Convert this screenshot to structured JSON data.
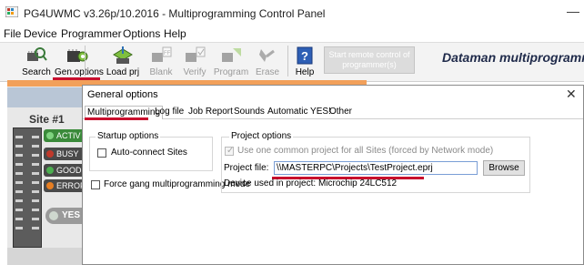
{
  "window": {
    "title": "PG4UWMC v3.26p/10.2016 - Multiprogramming Control Panel",
    "minimize_glyph": "—",
    "app_icon": "app-logo-icon"
  },
  "menu": [
    "File",
    "Device",
    "Programmer",
    "Options",
    "Help"
  ],
  "toolbar": {
    "buttons": [
      {
        "label": "Search",
        "icon": "search-chip-icon",
        "enabled": true
      },
      {
        "label": "Gen.options",
        "icon": "gen-options-icon",
        "enabled": true
      },
      {
        "label": "Load prj",
        "icon": "load-project-icon",
        "enabled": true
      },
      {
        "label": "Blank",
        "icon": "blank-icon",
        "enabled": false
      },
      {
        "label": "Verify",
        "icon": "verify-icon",
        "enabled": false
      },
      {
        "label": "Program",
        "icon": "program-icon",
        "enabled": false
      },
      {
        "label": "Erase",
        "icon": "erase-icon",
        "enabled": false
      },
      {
        "label": "Help",
        "icon": "help-icon",
        "enabled": true
      }
    ],
    "remote_button": "Start remote control of programmer(s)",
    "brand": "Dataman multiprogrammin"
  },
  "site": {
    "title": "Site #1",
    "statuses": [
      {
        "label": "ACTIV",
        "color": "#3a8a3a",
        "dot": "#7fd37f"
      },
      {
        "label": "BUSY",
        "color": "#4a4a4a",
        "dot": "#c0392b"
      },
      {
        "label": "GOOD",
        "color": "#4a4a4a",
        "dot": "#4caf50"
      },
      {
        "label": "ERROF",
        "color": "#4a4a4a",
        "dot": "#e67e22"
      }
    ],
    "yes_label": "YES"
  },
  "dialog": {
    "title": "General options",
    "close_glyph": "✕",
    "tabs": [
      "Multiprogramming",
      "Log file",
      "Job Report",
      "Sounds",
      "Automatic YES!",
      "Other"
    ],
    "active_tab": "Multiprogramming",
    "startup": {
      "title": "Startup options",
      "auto_connect": "Auto-connect Sites",
      "auto_connect_checked": false
    },
    "force_gang": "Force gang multiprogramming mode",
    "force_gang_checked": false,
    "project": {
      "title": "Project options",
      "use_common": "Use one common project for all Sites (forced by Network mode)",
      "use_common_checked": true,
      "file_label": "Project file:",
      "file_value": "\\\\MASTERPC\\Projects\\TestProject.eprj",
      "browse": "Browse",
      "device_used": "Device used in project: Microchip 24LC512"
    }
  },
  "colors": {
    "highlight_underline": "#c8102e",
    "orange_strip": "#f2a05a",
    "site_header": "#b9c6d6"
  }
}
